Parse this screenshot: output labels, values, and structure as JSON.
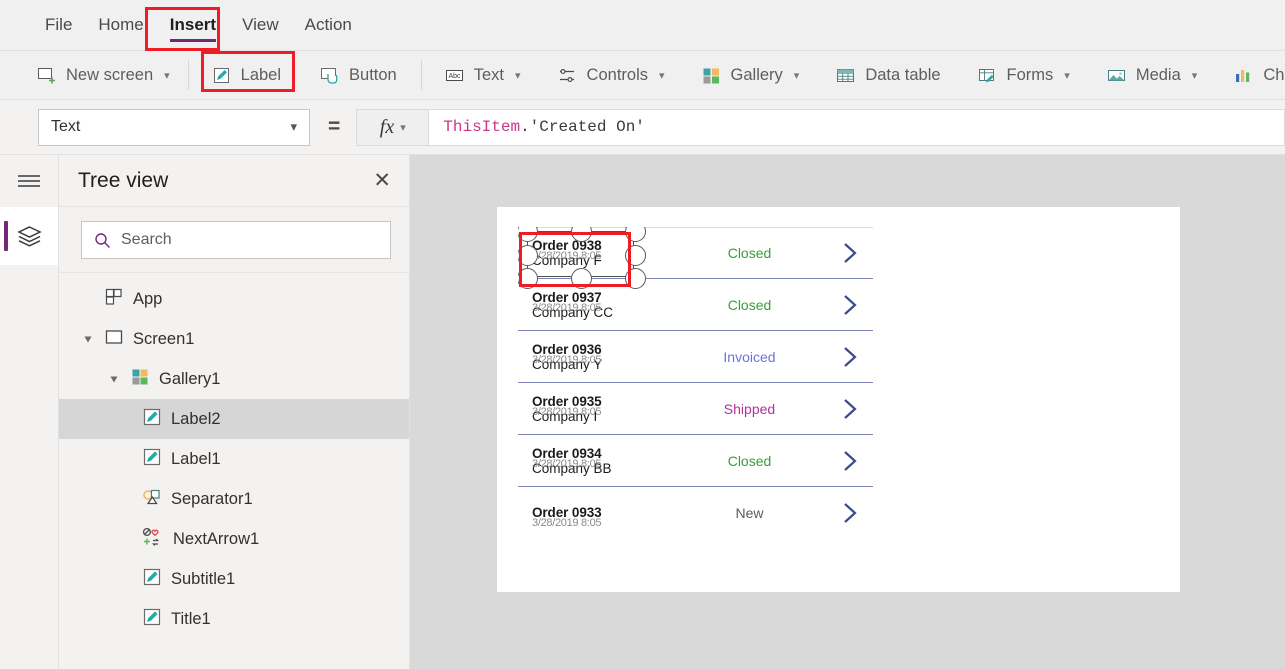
{
  "menubar": {
    "items": [
      {
        "label": "File",
        "active": false
      },
      {
        "label": "Home",
        "active": false
      },
      {
        "label": "Insert",
        "active": true
      },
      {
        "label": "View",
        "active": false
      },
      {
        "label": "Action",
        "active": false
      }
    ]
  },
  "ribbon": {
    "items": [
      {
        "label": "New screen",
        "icon": "new-screen-icon",
        "caret": true
      },
      {
        "label": "Label",
        "icon": "label-icon",
        "caret": false
      },
      {
        "label": "Button",
        "icon": "button-icon",
        "caret": false
      },
      {
        "label": "Text",
        "icon": "text-abc-icon",
        "caret": true
      },
      {
        "label": "Controls",
        "icon": "controls-sliders-icon",
        "caret": true
      },
      {
        "label": "Gallery",
        "icon": "gallery-icon",
        "caret": true
      },
      {
        "label": "Data table",
        "icon": "data-table-icon",
        "caret": false
      },
      {
        "label": "Forms",
        "icon": "forms-icon",
        "caret": true
      },
      {
        "label": "Media",
        "icon": "media-image-icon",
        "caret": true
      },
      {
        "label": "Char",
        "icon": "charts-icon",
        "caret": false
      }
    ]
  },
  "formulabar": {
    "property": "Text",
    "equals": "=",
    "fx": "fx",
    "formula_prefix": "ThisItem",
    "formula_rest": ".'Created On'"
  },
  "treeview": {
    "title": "Tree view",
    "close": "✕",
    "search_placeholder": "Search",
    "nodes": [
      {
        "label": "App",
        "icon": "app-icon",
        "indent": 0,
        "twisty": "none",
        "selected": false
      },
      {
        "label": "Screen1",
        "icon": "screen-icon",
        "indent": 0,
        "twisty": "expanded",
        "selected": false
      },
      {
        "label": "Gallery1",
        "icon": "gallery-icon",
        "indent": 1,
        "twisty": "expanded",
        "selected": false
      },
      {
        "label": "Label2",
        "icon": "label-icon",
        "indent": 2,
        "twisty": "none",
        "selected": true
      },
      {
        "label": "Label1",
        "icon": "label-icon",
        "indent": 2,
        "twisty": "none",
        "selected": false
      },
      {
        "label": "Separator1",
        "icon": "separator-icon",
        "indent": 2,
        "twisty": "none",
        "selected": false
      },
      {
        "label": "NextArrow1",
        "icon": "icon-set-icon",
        "indent": 2,
        "twisty": "none",
        "selected": false
      },
      {
        "label": "Subtitle1",
        "icon": "label-icon",
        "indent": 2,
        "twisty": "none",
        "selected": false
      },
      {
        "label": "Title1",
        "icon": "label-icon",
        "indent": 2,
        "twisty": "none",
        "selected": false
      }
    ]
  },
  "canvas": {
    "gallery_rows": [
      {
        "title": "Order 0938",
        "subtitle": "Company F",
        "date": "3/28/2019 8:05",
        "status": "Closed",
        "status_color": "#3a9c3a",
        "selected": true
      },
      {
        "title": "Order 0937",
        "subtitle": "Company CC",
        "date": "3/28/2019 8:05",
        "status": "Closed",
        "status_color": "#3a9c3a",
        "selected": false
      },
      {
        "title": "Order 0936",
        "subtitle": "Company Y",
        "date": "3/28/2019 8:05",
        "status": "Invoiced",
        "status_color": "#6e72d4",
        "selected": false
      },
      {
        "title": "Order 0935",
        "subtitle": "Company I",
        "date": "3/28/2019 8:05",
        "status": "Shipped",
        "status_color": "#b4309b",
        "selected": false
      },
      {
        "title": "Order 0934",
        "subtitle": "Company BB",
        "date": "3/28/2019 8:05",
        "status": "Closed",
        "status_color": "#3a9c3a",
        "selected": false
      },
      {
        "title": "Order 0933",
        "subtitle": "",
        "date": "3/28/2019 8:05",
        "status": "New",
        "status_color": "#5a5a5a",
        "selected": false
      }
    ]
  },
  "annotations": {
    "highlight_color": "#ee1c25",
    "boxes": [
      "insert-tab-highlight",
      "label-button-highlight",
      "selected-label-highlight"
    ]
  },
  "colors": {
    "accent_purple": "#742774",
    "chrome_gray": "#f0f0f0",
    "canvas_gray": "#d9d9d9",
    "selection_row": "#d6d6d6"
  }
}
